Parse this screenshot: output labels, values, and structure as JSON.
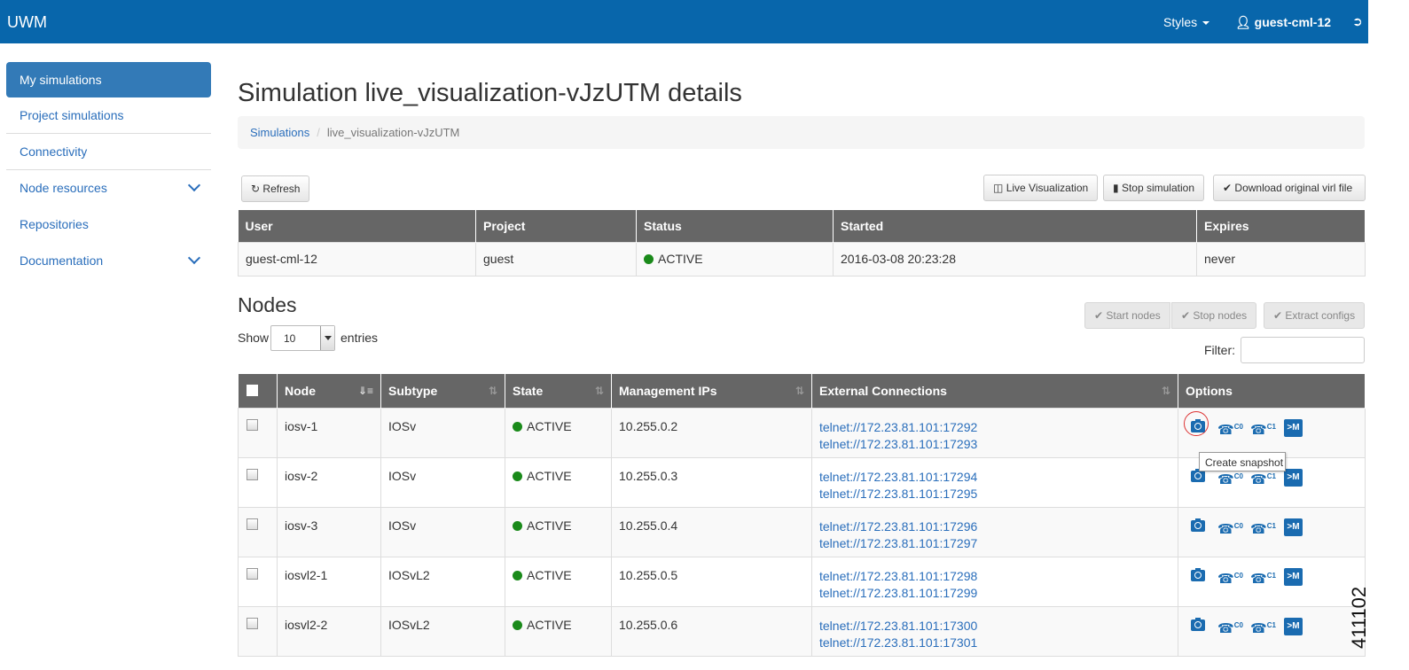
{
  "navbar": {
    "brand": "UWM",
    "styles_label": "Styles",
    "user_label": "guest-cml-12"
  },
  "sidebar": {
    "items": [
      {
        "label": "My simulations"
      },
      {
        "label": "Project simulations"
      },
      {
        "label": "Connectivity"
      },
      {
        "label": "Node resources"
      },
      {
        "label": "Repositories"
      },
      {
        "label": "Documentation"
      }
    ]
  },
  "page": {
    "title": "Simulation live_visualization-vJzUTM details",
    "breadcrumb": {
      "root": "Simulations",
      "current": "live_visualization-vJzUTM"
    }
  },
  "toolbar": {
    "refresh": "Refresh",
    "live_visualization": "Live Visualization",
    "stop_simulation": "Stop simulation",
    "download": "Download original virl file"
  },
  "sim_info": {
    "headers": [
      "User",
      "Project",
      "Status",
      "Started",
      "Expires"
    ],
    "row": {
      "user": "guest-cml-12",
      "project": "guest",
      "status": "ACTIVE",
      "started": "2016-03-08 20:23:28",
      "expires": "never"
    }
  },
  "nodes": {
    "title": "Nodes",
    "show_label": "Show",
    "page_size": "10",
    "entries_label": "entries",
    "filter_label": "Filter:",
    "buttons": {
      "start": "Start nodes",
      "stop": "Stop nodes",
      "extract": "Extract configs"
    },
    "headers": [
      "Node",
      "Subtype",
      "State",
      "Management IPs",
      "External Connections",
      "Options"
    ],
    "rows": [
      {
        "node": "iosv-1",
        "subtype": "IOSv",
        "state": "ACTIVE",
        "ip": "10.255.0.2",
        "c0": "telnet://172.23.81.101:17292",
        "c1": "telnet://172.23.81.101:17293"
      },
      {
        "node": "iosv-2",
        "subtype": "IOSv",
        "state": "ACTIVE",
        "ip": "10.255.0.3",
        "c0": "telnet://172.23.81.101:17294",
        "c1": "telnet://172.23.81.101:17295"
      },
      {
        "node": "iosv-3",
        "subtype": "IOSv",
        "state": "ACTIVE",
        "ip": "10.255.0.4",
        "c0": "telnet://172.23.81.101:17296",
        "c1": "telnet://172.23.81.101:17297"
      },
      {
        "node": "iosvl2-1",
        "subtype": "IOSvL2",
        "state": "ACTIVE",
        "ip": "10.255.0.5",
        "c0": "telnet://172.23.81.101:17298",
        "c1": "telnet://172.23.81.101:17299"
      },
      {
        "node": "iosvl2-2",
        "subtype": "IOSvL2",
        "state": "ACTIVE",
        "ip": "10.255.0.6",
        "c0": "telnet://172.23.81.101:17300",
        "c1": "telnet://172.23.81.101:17301"
      }
    ],
    "option_labels": {
      "console0": "C0",
      "console1": "C1",
      "terminal": ">M"
    },
    "tooltip": "Create snapshot"
  },
  "watermark": "411102",
  "colors": {
    "navbar": "#0866ab",
    "active_item": "#337ab7",
    "table_header": "#666666",
    "status_active": "#1a8a1a",
    "link": "#2a6ebb"
  }
}
